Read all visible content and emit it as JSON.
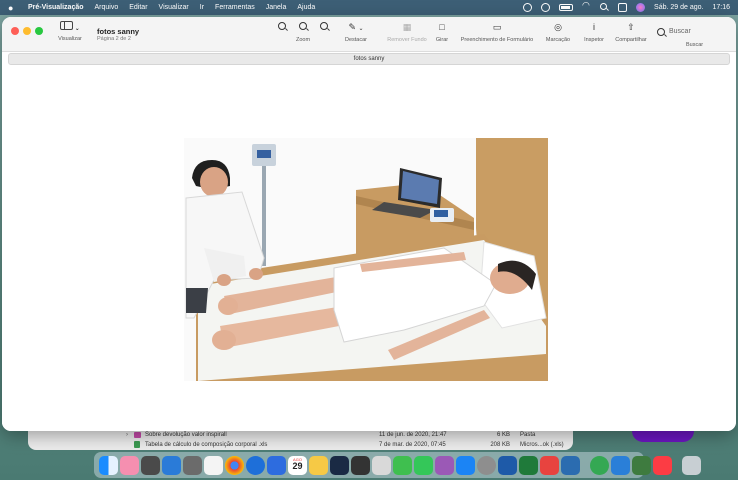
{
  "menubar": {
    "app": "Pré-Visualização",
    "menus": [
      "Arquivo",
      "Editar",
      "Visualizar",
      "Ir",
      "Ferramentas",
      "Janela",
      "Ajuda"
    ],
    "datetime": "Sáb. 29 de ago.",
    "time": "17:16"
  },
  "window": {
    "title": "fotos sanny",
    "subtitle": "Página 2 de 2",
    "tab_title": "fotos sanny",
    "toolbar": {
      "visualizar": "Visualizar",
      "zoom": "Zoom",
      "destacar": "Destacar",
      "remover_fundo": "Remover Fundo",
      "girar": "Girar",
      "preenchimento": "Preenchimento de Formulário",
      "marcacao": "Marcação",
      "inspetor": "Inspetor",
      "compartilhar": "Compartilhar",
      "buscar_placeholder": "Buscar",
      "buscar_label": "Buscar"
    }
  },
  "background_window": {
    "rows": [
      {
        "name": "Sobre devolução valor inspirall",
        "date": "11 de jun. de 2020, 21:47",
        "size": "6 KB",
        "kind": "Pasta"
      },
      {
        "name": "Tabela de cálculo de composição corporal .xls",
        "date": "7 de mar. de 2020, 07:45",
        "size": "208 KB",
        "kind": "Micros...ok (.xls)"
      }
    ]
  },
  "dock": {
    "calendar_month": "AGO",
    "calendar_day": "29",
    "colors": [
      "#1a8cff",
      "#f58fb0",
      "#4a4a4a",
      "#2a7bd8",
      "#6b6b6b",
      "#f4f4f4",
      "#ea4335",
      "#1e6fd9",
      "#2d6cdf",
      "#ffffff",
      "#f6c945",
      "#1a2a44",
      "#333333",
      "#d9d9d9",
      "#3fbf4f",
      "#9b59b6",
      "#1b84f5",
      "#ff9500",
      "#8e8e8e",
      "#1e5aa8",
      "#1f7a3a",
      "#e8433f",
      "#2b6cb0",
      "#3e7b3f",
      "#2a7fd8",
      "#34a853",
      "#fc3c44"
    ]
  }
}
